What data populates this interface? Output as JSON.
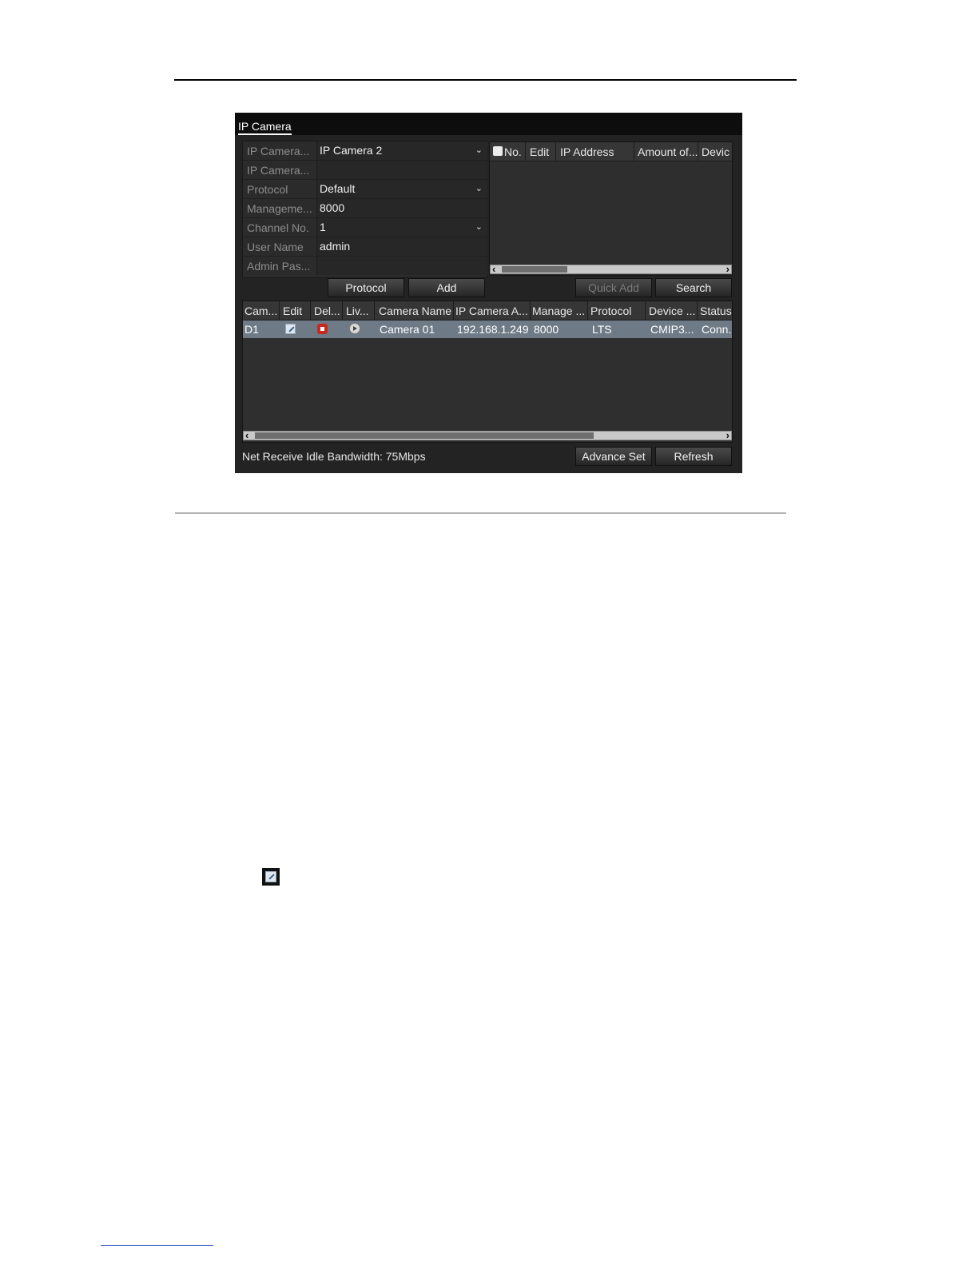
{
  "dialog": {
    "title": "IP Camera",
    "form": {
      "rows": [
        {
          "label": "IP Camera...",
          "value": "IP Camera 2",
          "dropdown": true
        },
        {
          "label": "IP Camera...",
          "value": "",
          "dropdown": false
        },
        {
          "label": "Protocol",
          "value": "Default",
          "dropdown": true
        },
        {
          "label": "Manageme...",
          "value": "8000",
          "dropdown": false
        },
        {
          "label": "Channel No.",
          "value": "1",
          "dropdown": true
        },
        {
          "label": "User Name",
          "value": "admin",
          "dropdown": false
        },
        {
          "label": "Admin Pas...",
          "value": "",
          "dropdown": false
        }
      ]
    },
    "search_table": {
      "headers": [
        "No.",
        "Edit",
        "IP Address",
        "Amount of...",
        "Devic"
      ]
    },
    "buttons": {
      "protocol": "Protocol",
      "add": "Add",
      "quick_add": "Quick Add",
      "search": "Search",
      "advance_set": "Advance Set",
      "refresh": "Refresh"
    },
    "camera_table": {
      "headers": [
        "Cam...",
        "Edit",
        "Del...",
        "Liv...",
        "Camera Name",
        "IP Camera A...",
        "Manage ...",
        "Protocol",
        "Device ...",
        "Status"
      ],
      "rows": [
        {
          "cam": "D1",
          "camera_name": "Camera 01",
          "ip": "192.168.1.249",
          "manage_port": "8000",
          "protocol": "LTS",
          "device": "CMIP3...",
          "status": "Conn."
        }
      ]
    },
    "bandwidth_text": "Net Receive Idle Bandwidth: 75Mbps"
  },
  "icons": {
    "edit": "edit-icon",
    "delete": "delete-icon",
    "live": "live-view-icon",
    "dropdown": "chevron-down-icon"
  }
}
